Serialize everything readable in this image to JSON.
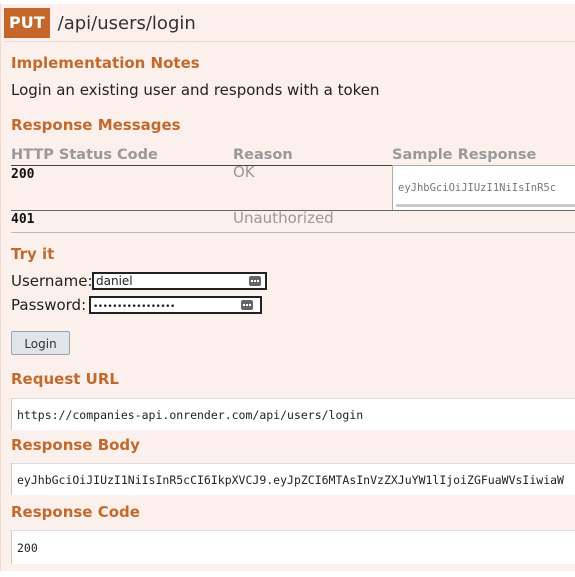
{
  "operation": {
    "method": "PUT",
    "path": "/api/users/login"
  },
  "implementation_notes": {
    "heading": "Implementation Notes",
    "text": "Login an existing user and responds with a token"
  },
  "response_messages": {
    "heading": "Response Messages",
    "columns": [
      "HTTP Status Code",
      "Reason",
      "Sample Response"
    ],
    "rows": [
      {
        "code": "200",
        "reason": "OK",
        "sample": "eyJhbGciOiJIUzI1NiIsInR5c"
      },
      {
        "code": "401",
        "reason": "Unauthorized",
        "sample": ""
      }
    ]
  },
  "try_it": {
    "heading": "Try it",
    "username_label": "Username:",
    "username_value": "daniel",
    "password_label": "Password:",
    "password_value": "•••••••••••••••••",
    "login_button": "Login"
  },
  "request_url": {
    "heading": "Request URL",
    "value": "https://companies-api.onrender.com/api/users/login"
  },
  "response_body": {
    "heading": "Response Body",
    "value": "eyJhbGciOiJIUzI1NiIsInR5cCI6IkpXVCJ9.eyJpZCI6MTAsInVzZXJuYW1lIjoiZGFuaWVsIiwiaW"
  },
  "response_code": {
    "heading": "Response Code",
    "value": "200"
  },
  "colors": {
    "accent": "#c5672b",
    "heading": "#c26a2e",
    "panel_bg": "#fbf0ec",
    "muted": "#999999"
  }
}
